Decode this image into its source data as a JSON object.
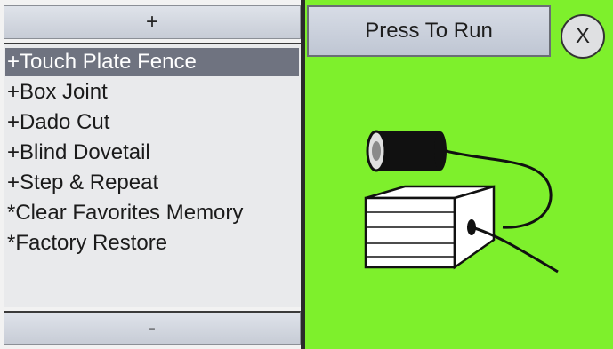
{
  "menu": {
    "scroll_up_label": "+",
    "scroll_down_label": "-",
    "items": [
      {
        "label": "+Touch Plate Fence",
        "selected": true
      },
      {
        "label": "+Box Joint",
        "selected": false
      },
      {
        "label": "+Dado Cut",
        "selected": false
      },
      {
        "label": "+Blind Dovetail",
        "selected": false
      },
      {
        "label": "+Step & Repeat",
        "selected": false
      },
      {
        "label": "*Clear Favorites Memory",
        "selected": false
      },
      {
        "label": "*Factory Restore",
        "selected": false
      }
    ]
  },
  "action": {
    "run_label": "Press To Run",
    "close_label": "X"
  },
  "colors": {
    "panel_bg": "#7ef02c",
    "selected_item_bg": "#6f7380"
  },
  "illustration": {
    "icon": "touch-plate-icon"
  }
}
